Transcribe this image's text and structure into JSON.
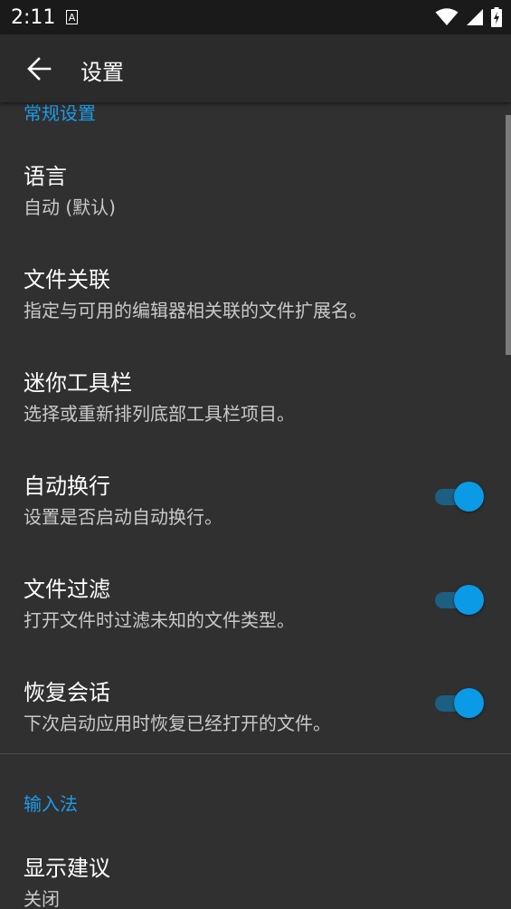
{
  "status_bar": {
    "time": "2:11",
    "notification_glyph": "A",
    "icons": [
      "wifi-icon",
      "signal-icon",
      "battery-charging-icon"
    ]
  },
  "app_bar": {
    "back_icon": "arrow-back-icon",
    "title": "设置"
  },
  "sections": {
    "general": {
      "title": "常规设置"
    },
    "input_method": {
      "title": "输入法"
    }
  },
  "prefs": {
    "language": {
      "title": "语言",
      "summary": "自动 (默认)"
    },
    "file_association": {
      "title": "文件关联",
      "summary": "指定与可用的编辑器相关联的文件扩展名。"
    },
    "mini_toolbar": {
      "title": "迷你工具栏",
      "summary": "选择或重新排列底部工具栏项目。"
    },
    "word_wrap": {
      "title": "自动换行",
      "summary": "设置是否启动自动换行。",
      "enabled": true
    },
    "file_filter": {
      "title": "文件过滤",
      "summary": "打开文件时过滤未知的文件类型。",
      "enabled": true
    },
    "restore_session": {
      "title": "恢复会话",
      "summary": "下次启动应用时恢复已经打开的文件。",
      "enabled": true
    },
    "show_suggestions": {
      "title": "显示建议",
      "summary": "关闭"
    }
  },
  "colors": {
    "accent": "#1e9be8",
    "background": "#303030",
    "app_bar": "#2b2b2b",
    "status_bar": "#1a1a1a"
  }
}
